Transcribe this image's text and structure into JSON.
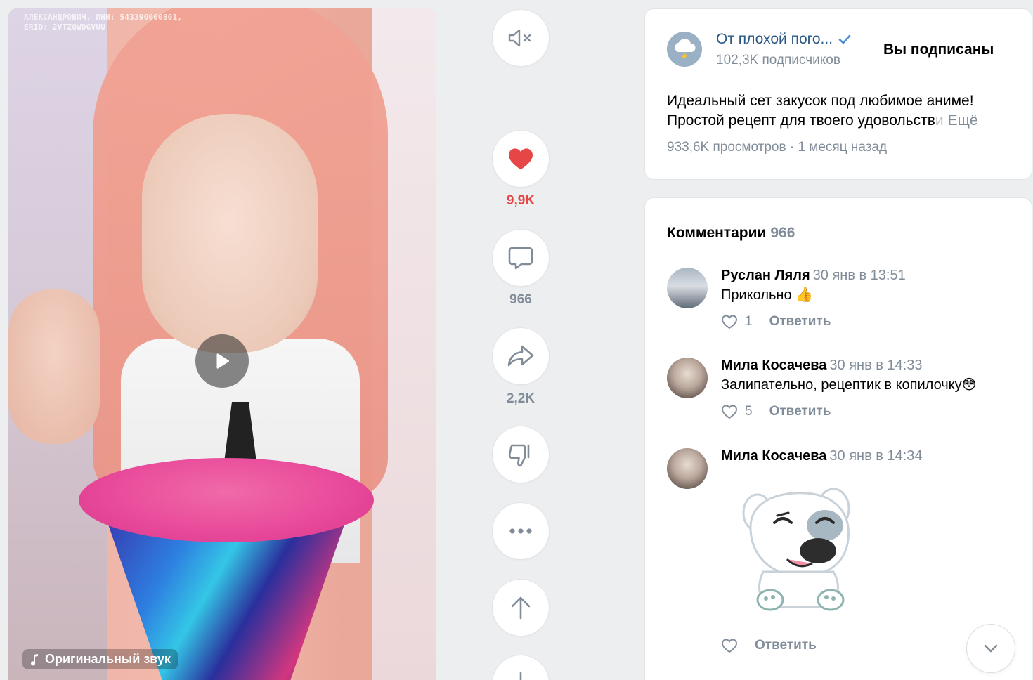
{
  "video": {
    "watermark_line1": "АЛЕКСАНДРОВИЧ, ИНН: 543390000801,",
    "watermark_line2": "ERID: 2VTZQWDGVUU",
    "sound_label": "Оригинальный звук",
    "play_icon": "play-icon",
    "music_icon": "music-note-icon"
  },
  "actions": {
    "mute_icon": "speaker-muted-icon",
    "like_icon": "heart-filled-icon",
    "like_count": "9,9K",
    "comment_icon": "comment-bubble-icon",
    "comment_count": "966",
    "share_icon": "share-arrow-icon",
    "share_count": "2,2K",
    "dislike_icon": "thumbs-down-icon",
    "more_icon": "more-dots-icon",
    "prev_icon": "arrow-up-icon",
    "next_icon": "arrow-down-icon",
    "like_color": "#e64646"
  },
  "channel": {
    "name": "От плохой пого...",
    "subscribers": "102,3K подписчиков",
    "subscribed_label": "Вы подписаны",
    "verified_icon": "checkmark-verified-icon"
  },
  "description": {
    "line1": "Идеальный сет закусок под любимое аниме!",
    "line2": "Простой рецепт для твоего удовольств",
    "line2_fade": "и",
    "more": "Ещё",
    "views": "933,6K просмотров",
    "separator": "·",
    "posted": "1 месяц назад"
  },
  "comments": {
    "title": "Комментарии",
    "count": "966",
    "items": [
      {
        "author": "Руслан Ляля",
        "time": "30 янв в 13:51",
        "text": "Прикольно",
        "emoji": "👍",
        "likes": "1",
        "reply": "Ответить"
      },
      {
        "author": "Мила Косачева",
        "time": "30 янв в 14:33",
        "text": "Залипательно, рецептик в копилочку",
        "emoji": "😳",
        "likes": "5",
        "reply": "Ответить"
      },
      {
        "author": "Мила Косачева",
        "time": "30 янв в 14:34",
        "text": "",
        "likes": "",
        "reply": "Ответить",
        "sticker": "dog-sticker"
      }
    ]
  },
  "scroll_icon": "chevron-down-icon"
}
